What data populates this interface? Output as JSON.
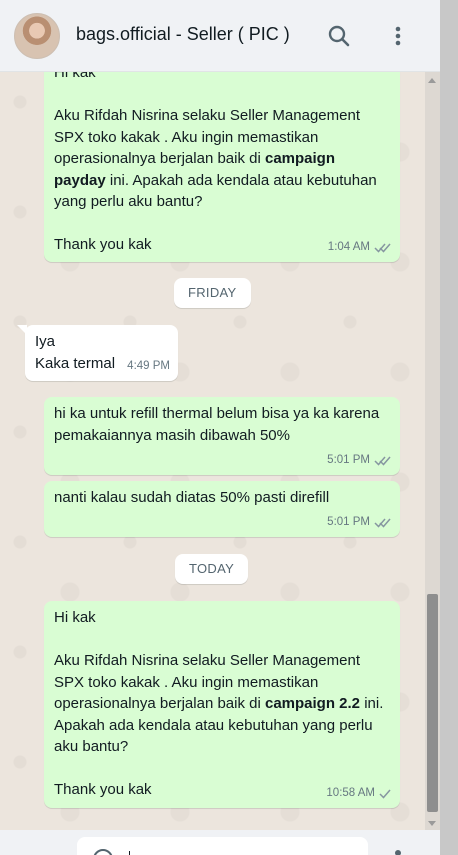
{
  "header": {
    "contact_name": "bags.official - Seller ( PIC )",
    "search_icon": "search-icon",
    "menu_icon": "kebab-menu-icon"
  },
  "chat": {
    "messages": [
      {
        "direction": "outgoing",
        "first_line": "Hi kak",
        "paragraph_a": "Aku Rifdah Nisrina selaku Seller Management SPX toko kakak . Aku ingin memastikan operasionalnya berjalan baik di ",
        "bold": "campaign payday",
        "paragraph_b": " ini. Apakah ada kendala atau kebutuhan yang perlu aku bantu?",
        "closing": "Thank you kak",
        "time": "1:04 AM",
        "status": "read"
      },
      {
        "direction": "date",
        "label": "FRIDAY"
      },
      {
        "direction": "incoming",
        "text": "Iya\nKaka termal",
        "time": "4:49 PM"
      },
      {
        "direction": "outgoing",
        "text": "hi ka untuk refill thermal belum bisa ya ka karena pemakaiannya masih dibawah 50%",
        "time": "5:01 PM",
        "status": "read"
      },
      {
        "direction": "outgoing",
        "text": "nanti kalau sudah diatas 50% pasti direfill",
        "time": "5:01 PM",
        "status": "read"
      },
      {
        "direction": "date",
        "label": "TODAY"
      },
      {
        "direction": "outgoing",
        "first_line": "Hi kak",
        "paragraph_a": "Aku Rifdah Nisrina selaku Seller Management SPX toko kakak . Aku ingin memastikan operasionalnya berjalan baik di ",
        "bold": "campaign 2.2",
        "paragraph_b": " ini. Apakah ada kendala atau kebutuhan yang perlu aku bantu?",
        "closing": "Thank you kak",
        "time": "10:58 AM",
        "status": "sent"
      }
    ]
  },
  "colors": {
    "outgoing_bubble": "#d9fdd3",
    "incoming_bubble": "#ffffff",
    "header_bg": "#f0f2f5",
    "read_tick": "#8696a0"
  }
}
